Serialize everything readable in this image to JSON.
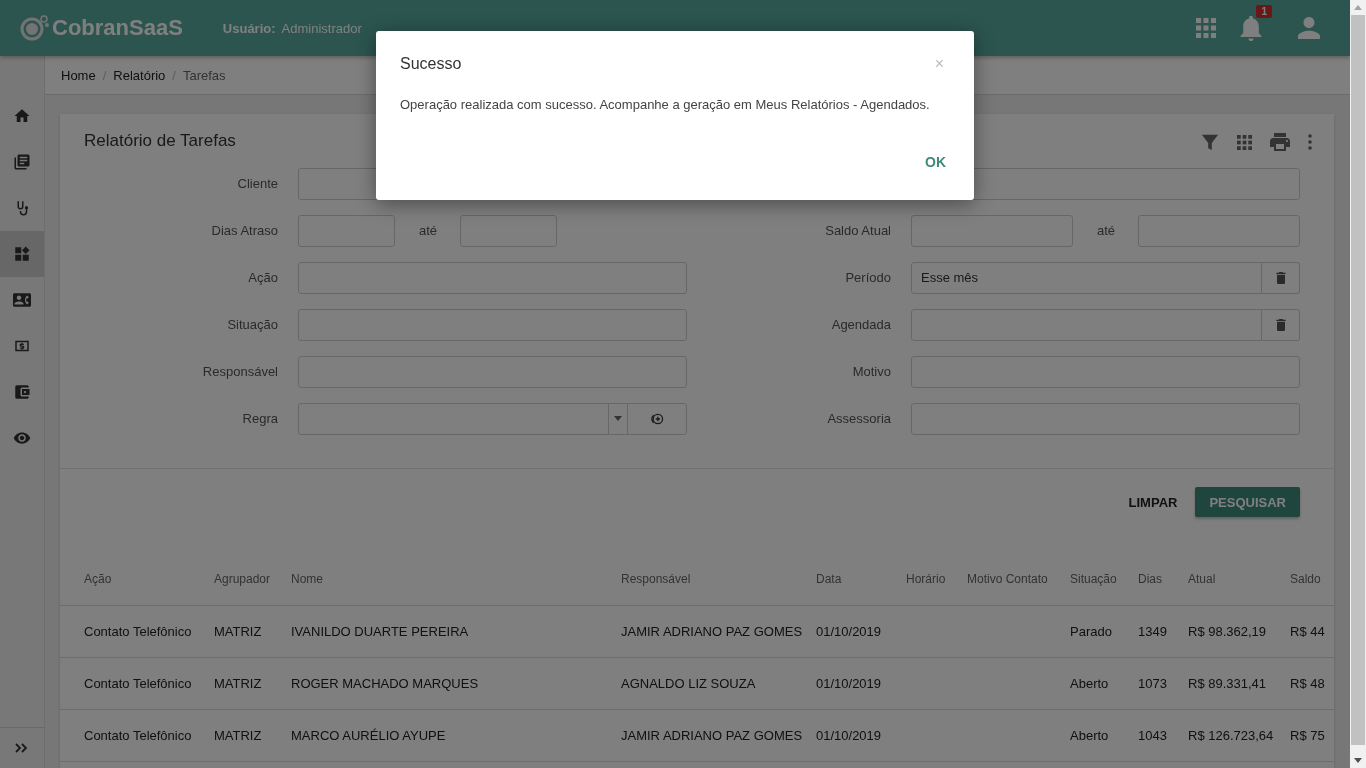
{
  "header": {
    "logo": "CobranSaaS",
    "user_label": "Usuário:",
    "user": "Administrador",
    "notification_count": "1"
  },
  "sidebar": {
    "items": [
      {
        "selected": false
      },
      {
        "selected": false
      },
      {
        "selected": false
      },
      {
        "selected": true
      },
      {
        "selected": false
      },
      {
        "selected": false
      },
      {
        "selected": false
      },
      {
        "selected": false
      }
    ]
  },
  "breadcrumb": {
    "separator": "/",
    "items": [
      "Home",
      "Relatório",
      "Tarefas"
    ]
  },
  "card": {
    "title": "Relatório de Tarefas"
  },
  "form": {
    "rows": [
      {
        "left": {
          "label": "Cliente",
          "kind": "wide"
        }
      },
      {
        "left": {
          "label": "Dias Atraso",
          "kind": "range",
          "separator": "até"
        },
        "right": {
          "label": "Saldo Atual",
          "kind": "range",
          "separator": "até"
        }
      },
      {
        "left": {
          "label": "Ação",
          "kind": "text"
        },
        "right": {
          "label": "Período",
          "kind": "clearable",
          "value": "Esse mês"
        }
      },
      {
        "left": {
          "label": "Situação",
          "kind": "text"
        },
        "right": {
          "label": "Agendada",
          "kind": "clearable"
        }
      },
      {
        "left": {
          "label": "Responsável",
          "kind": "text"
        },
        "right": {
          "label": "Motivo",
          "kind": "text"
        }
      },
      {
        "left": {
          "label": "Regra",
          "kind": "select"
        },
        "right": {
          "label": "Assessoria",
          "kind": "text"
        }
      }
    ]
  },
  "actions": [
    "LIMPAR",
    "PESQUISAR"
  ],
  "table": {
    "columns": [
      "Ação",
      "Agrupador",
      "Nome",
      "Responsável",
      "Data",
      "Horário",
      "Motivo Contato",
      "Situação",
      "Dias",
      "Atual",
      "Saldo"
    ],
    "rows": [
      [
        "Contato Telefônico",
        "MATRIZ",
        "IVANILDO DUARTE PEREIRA",
        "JAMIR ADRIANO PAZ GOMES",
        "01/10/2019",
        "",
        "",
        "Parado",
        "1349",
        "R$ 98.362,19",
        "R$ 44"
      ],
      [
        "Contato Telefônico",
        "MATRIZ",
        "ROGER MACHADO MARQUES",
        "AGNALDO LIZ SOUZA",
        "01/10/2019",
        "",
        "",
        "Aberto",
        "1073",
        "R$ 89.331,41",
        "R$ 48"
      ],
      [
        "Contato Telefônico",
        "MATRIZ",
        "MARCO AURÉLIO AYUPE",
        "JAMIR ADRIANO PAZ GOMES",
        "01/10/2019",
        "",
        "",
        "Aberto",
        "1043",
        "R$ 126.723,64",
        "R$ 75"
      ]
    ]
  },
  "dialog": {
    "title": "Sucesso",
    "close": "×",
    "message": "Operação realizada com sucesso. Acompanhe a geração em Meus Relatórios - Agendados.",
    "button": "OK"
  }
}
